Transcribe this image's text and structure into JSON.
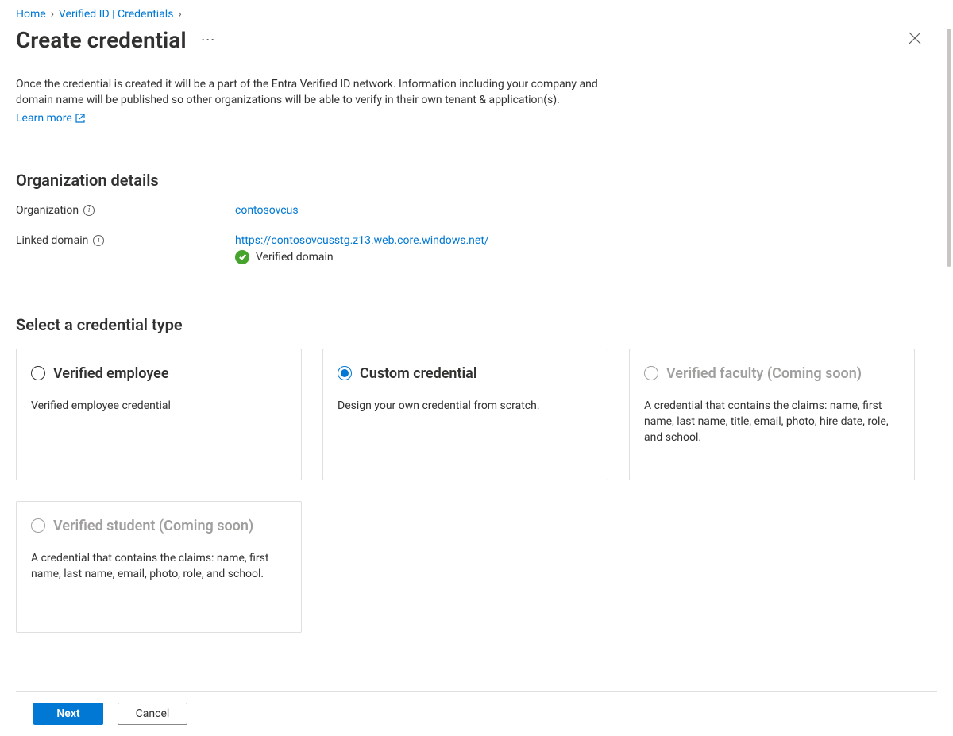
{
  "breadcrumb": {
    "home": "Home",
    "verified_id": "Verified ID | Credentials"
  },
  "title": "Create credential",
  "intro": "Once the credential is created it will be a part of the Entra Verified ID network. Information including your company and domain name will be published so other organizations will be able to verify in their own tenant & application(s).",
  "learn_more": "Learn more",
  "sections": {
    "org_details": "Organization details",
    "select_type": "Select a credential type"
  },
  "org": {
    "label": "Organization",
    "value": "contosovcus",
    "domain_label": "Linked domain",
    "domain_value": "https://contosovcusstg.z13.web.core.windows.net/",
    "verified_text": "Verified domain"
  },
  "cards": {
    "employee": {
      "title": "Verified employee",
      "desc": "Verified employee credential"
    },
    "custom": {
      "title": "Custom credential",
      "desc": "Design your own credential from scratch."
    },
    "faculty": {
      "title": "Verified faculty (Coming soon)",
      "desc": "A credential that contains the claims: name, first name, last name, title, email, photo, hire date, role, and school."
    },
    "student": {
      "title": "Verified student (Coming soon)",
      "desc": "A credential that contains the claims: name, first name, last name, email, photo, role, and school."
    }
  },
  "footer": {
    "next": "Next",
    "cancel": "Cancel"
  }
}
